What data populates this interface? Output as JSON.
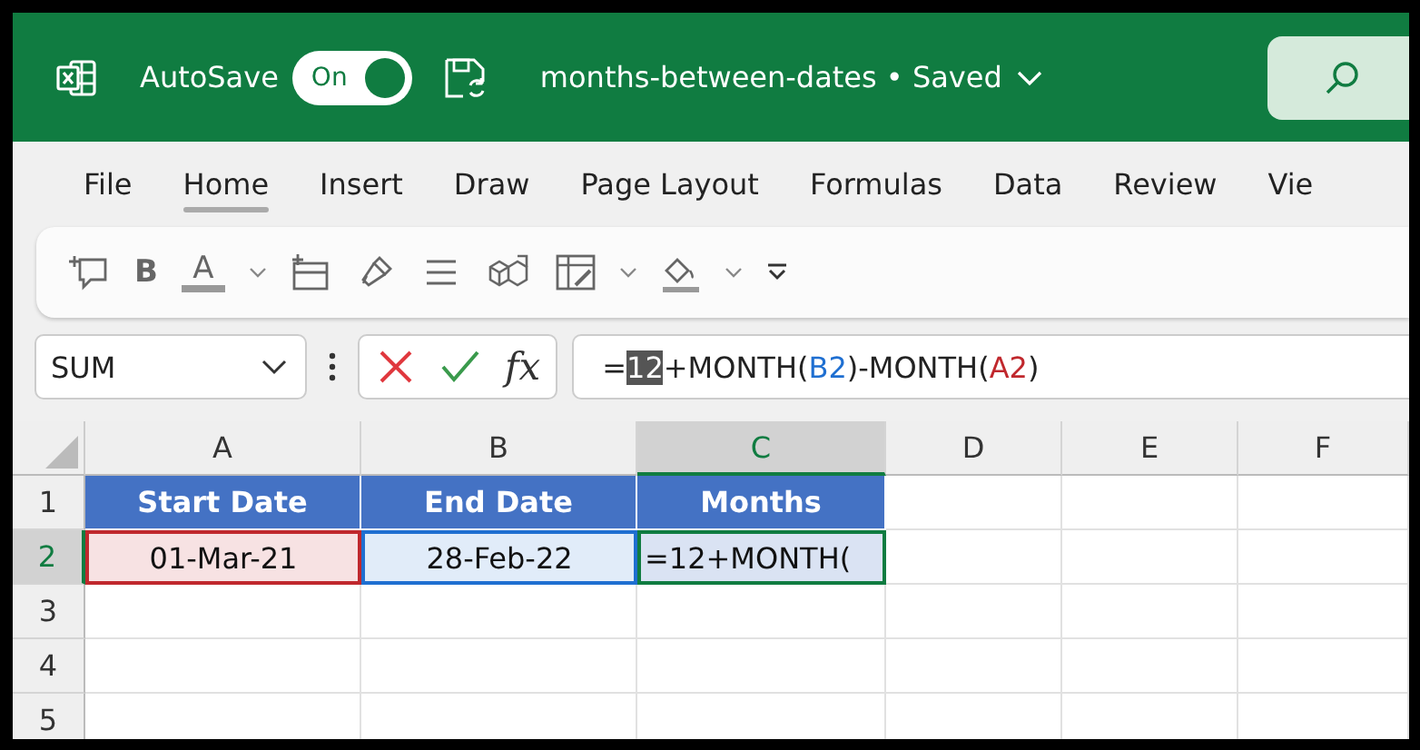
{
  "title_bar": {
    "autosave_label": "AutoSave",
    "autosave_toggle": {
      "label": "On",
      "on": true
    },
    "document_title": "months-between-dates • Saved"
  },
  "ribbon_tabs": [
    {
      "label": "File",
      "selected": false
    },
    {
      "label": "Home",
      "selected": true
    },
    {
      "label": "Insert",
      "selected": false
    },
    {
      "label": "Draw",
      "selected": false
    },
    {
      "label": "Page Layout",
      "selected": false
    },
    {
      "label": "Formulas",
      "selected": false
    },
    {
      "label": "Data",
      "selected": false
    },
    {
      "label": "Review",
      "selected": false
    },
    {
      "label": "Vie",
      "selected": false
    }
  ],
  "toolbar": {
    "bold_label": "B",
    "font_color_label": "A"
  },
  "formula_bar": {
    "name_box": "SUM",
    "fx_label": "fx",
    "formula_parts": [
      {
        "text": "=",
        "kind": "plain"
      },
      {
        "text": "12",
        "kind": "selected"
      },
      {
        "text": "+MONTH(",
        "kind": "plain"
      },
      {
        "text": "B2",
        "kind": "ref",
        "color": "#1f6fd1"
      },
      {
        "text": ")-MONTH(",
        "kind": "plain"
      },
      {
        "text": "A2",
        "kind": "ref",
        "color": "#c0282d"
      },
      {
        "text": ")",
        "kind": "plain"
      }
    ]
  },
  "sheet": {
    "columns": [
      {
        "label": "A",
        "selected": false
      },
      {
        "label": "B",
        "selected": false
      },
      {
        "label": "C",
        "selected": true
      },
      {
        "label": "D",
        "selected": false
      },
      {
        "label": "E",
        "selected": false
      },
      {
        "label": "F",
        "selected": false
      }
    ],
    "rows": [
      {
        "label": "1",
        "selected": false,
        "cells": [
          {
            "text": "Start Date",
            "kind": "header"
          },
          {
            "text": "End Date",
            "kind": "header"
          },
          {
            "text": "Months",
            "kind": "header"
          }
        ]
      },
      {
        "label": "2",
        "selected": true,
        "cells": [
          {
            "text": "01-Mar-21",
            "kind": "ref",
            "color": "#c0282d"
          },
          {
            "text": "28-Feb-22",
            "kind": "ref",
            "color": "#1f6fd1"
          },
          {
            "text": "=12+MONTH(",
            "kind": "editing"
          }
        ]
      },
      {
        "label": "3",
        "selected": false,
        "cells": []
      },
      {
        "label": "4",
        "selected": false,
        "cells": []
      },
      {
        "label": "5",
        "selected": false,
        "cells": []
      }
    ]
  }
}
